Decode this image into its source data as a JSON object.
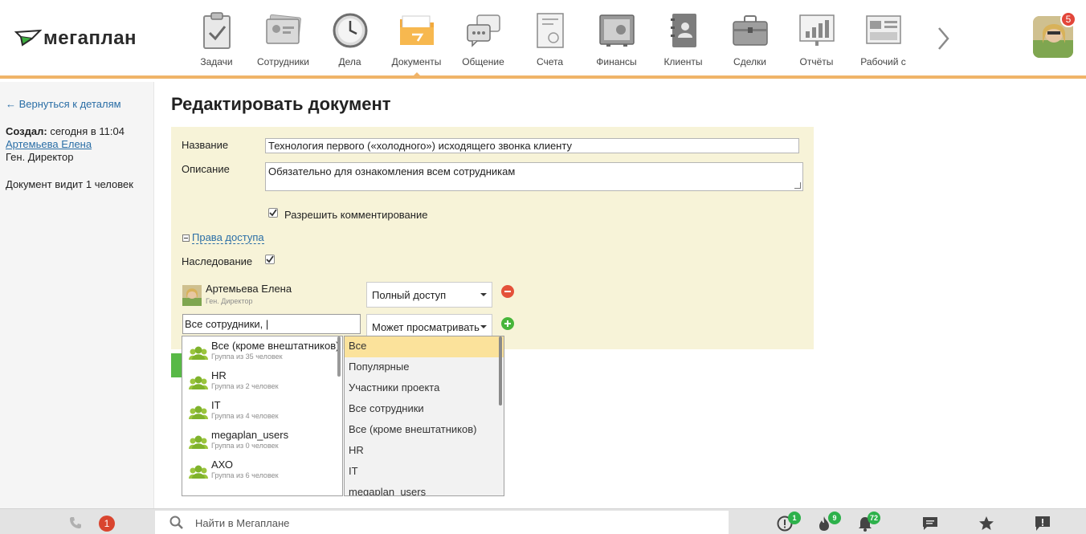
{
  "app": {
    "logo_text": "мегаплан",
    "notification_count": "5"
  },
  "nav": {
    "items": [
      {
        "label": "Задачи",
        "icon": "tasks-clipboard-icon"
      },
      {
        "label": "Сотрудники",
        "icon": "employees-card-icon"
      },
      {
        "label": "Дела",
        "icon": "clock-icon"
      },
      {
        "label": "Документы",
        "icon": "documents-folder-icon"
      },
      {
        "label": "Общение",
        "icon": "chat-bubbles-icon"
      },
      {
        "label": "Счета",
        "icon": "invoice-icon"
      },
      {
        "label": "Финансы",
        "icon": "safe-icon"
      },
      {
        "label": "Клиенты",
        "icon": "contacts-book-icon"
      },
      {
        "label": "Сделки",
        "icon": "briefcase-icon"
      },
      {
        "label": "Отчёты",
        "icon": "report-chart-icon"
      },
      {
        "label": "Рабочий с",
        "icon": "dashboard-icon"
      }
    ],
    "active_index": 3
  },
  "sidebar": {
    "back_link": "← Вернуться к деталям",
    "created_label": "Создал:",
    "created_value": " сегодня в 11:04",
    "author_name": "Артемьева Елена",
    "author_role": "Ген. Директор",
    "visibility": "Документ видит 1 человек"
  },
  "page": {
    "title": "Редактировать документ"
  },
  "form": {
    "name_label": "Название",
    "name_value": "Технология первого («холодного») исходящего звонка клиенту",
    "description_label": "Описание",
    "description_value": "Обязательно для ознакомления всем сотрудникам",
    "allow_comments_label": "Разрешить комментирование",
    "allow_comments_checked": true,
    "access_rights_link": "Права доступа",
    "inheritance_label": "Наследование",
    "inheritance_checked": true,
    "access_user": {
      "name": "Артемьева Елена",
      "role": "Ген. Директор",
      "permission": "Полный доступ"
    },
    "new_access": {
      "search_value": "Все сотрудники, |",
      "permission": "Может просматривать"
    }
  },
  "group_dropdown": [
    {
      "name": "Все (кроме внештатников)",
      "sub": "Группа из 35 человек"
    },
    {
      "name": "HR",
      "sub": "Группа из 2 человек"
    },
    {
      "name": "IT",
      "sub": "Группа из 4 человек"
    },
    {
      "name": "megaplan_users",
      "sub": "Группа из 0 человек"
    },
    {
      "name": "АХО",
      "sub": "Группа из 6 человек"
    }
  ],
  "filter_dropdown": {
    "items": [
      "Все",
      "Популярные",
      "Участники проекта",
      "Все сотрудники",
      "Все (кроме внештатников)",
      "HR",
      "IT",
      "megaplan_users"
    ],
    "selected_index": 0
  },
  "footer": {
    "missed_calls": "1",
    "search_placeholder": "Найти в Мегаплане",
    "alerts_badge": "1",
    "hot_badge": "9",
    "bell_badge": "72"
  },
  "colors": {
    "accent_orange": "#f0b469",
    "panel_bg": "#f7f3d8",
    "link_blue": "#2a6ea6",
    "badge_red": "#e2463a",
    "badge_green": "#2db14b",
    "selected_row": "#fbe29b"
  }
}
